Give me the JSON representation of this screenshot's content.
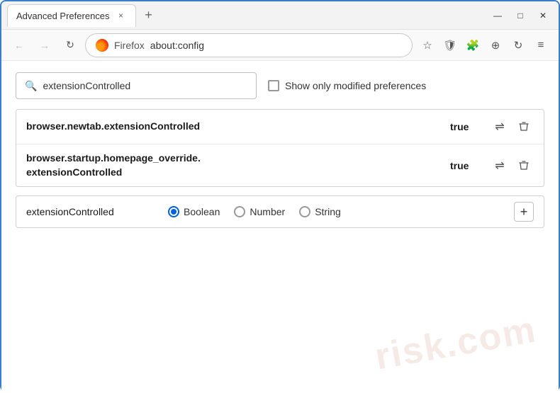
{
  "titlebar": {
    "tab_title": "Advanced Preferences",
    "close_tab": "×",
    "new_tab": "+",
    "minimize": "—",
    "maximize": "□",
    "close_window": "✕"
  },
  "navbar": {
    "back": "←",
    "forward": "→",
    "refresh": "↻",
    "browser_name": "Firefox",
    "address": "about:config",
    "bookmark_icon": "☆",
    "shield_icon": "🛡",
    "extension_icon": "🧩",
    "download_icon": "⊕",
    "sync_icon": "↻",
    "menu_icon": "≡"
  },
  "search": {
    "placeholder": "extensionControlled",
    "value": "extensionControlled",
    "checkbox_label": "Show only modified preferences"
  },
  "preferences": [
    {
      "name": "browser.newtab.extensionControlled",
      "value": "true"
    },
    {
      "name": "browser.startup.homepage_override.\nextensionControlled",
      "name_line1": "browser.startup.homepage_override.",
      "name_line2": "extensionControlled",
      "value": "true",
      "multiline": true
    }
  ],
  "add_preference": {
    "name": "extensionControlled",
    "type_options": [
      "Boolean",
      "Number",
      "String"
    ],
    "selected_type": "Boolean",
    "add_button": "+"
  },
  "watermark": "risk.com",
  "icons": {
    "search": "🔍",
    "swap": "⇌",
    "delete": "🗑",
    "radio_selected": "●",
    "radio_empty": "○"
  }
}
